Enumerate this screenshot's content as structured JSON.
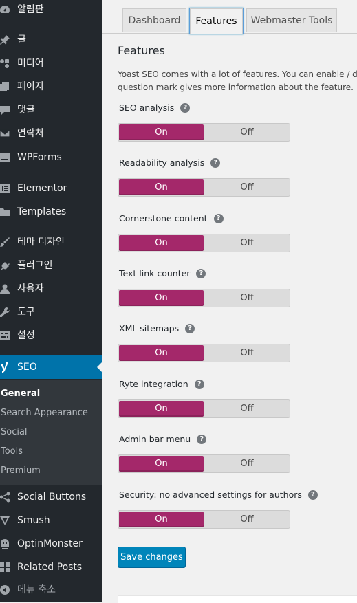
{
  "sidebar": {
    "items": [
      {
        "label": "알림판",
        "icon": "dashboard-icon"
      },
      {
        "label": "글",
        "icon": "pin-icon"
      },
      {
        "label": "미디어",
        "icon": "media-icon"
      },
      {
        "label": "페이지",
        "icon": "pages-icon"
      },
      {
        "label": "댓글",
        "icon": "comments-icon"
      },
      {
        "label": "연락처",
        "icon": "mail-icon"
      },
      {
        "label": "WPForms",
        "icon": "forms-icon"
      },
      {
        "label": "Elementor",
        "icon": "elementor-icon"
      },
      {
        "label": "Templates",
        "icon": "folder-icon"
      },
      {
        "label": "테마 디자인",
        "icon": "brush-icon"
      },
      {
        "label": "플러그인",
        "icon": "plugin-icon"
      },
      {
        "label": "사용자",
        "icon": "user-icon"
      },
      {
        "label": "도구",
        "icon": "wrench-icon"
      },
      {
        "label": "설정",
        "icon": "settings-icon"
      },
      {
        "label": "SEO",
        "icon": "yoast-icon"
      },
      {
        "label": "Social Buttons",
        "icon": "share-icon"
      },
      {
        "label": "Smush",
        "icon": "smush-icon"
      },
      {
        "label": "OptinMonster",
        "icon": "monster-icon"
      },
      {
        "label": "Related Posts",
        "icon": "grid-icon"
      },
      {
        "label": "메뉴 축소",
        "icon": "collapse-icon"
      }
    ],
    "submenu": [
      {
        "label": "General"
      },
      {
        "label": "Search Appearance"
      },
      {
        "label": "Social"
      },
      {
        "label": "Tools"
      },
      {
        "label": "Premium"
      }
    ]
  },
  "tabs": [
    {
      "label": "Dashboard"
    },
    {
      "label": "Features"
    },
    {
      "label": "Webmaster Tools"
    }
  ],
  "section": {
    "title": "Features",
    "description_line1": "Yoast SEO comes with a lot of features. You can enable / disa",
    "description_line2": "question mark gives more information about the feature."
  },
  "features": [
    {
      "label": "SEO analysis",
      "on": "On",
      "off": "Off",
      "state": "on"
    },
    {
      "label": "Readability analysis",
      "on": "On",
      "off": "Off",
      "state": "on"
    },
    {
      "label": "Cornerstone content",
      "on": "On",
      "off": "Off",
      "state": "on"
    },
    {
      "label": "Text link counter",
      "on": "On",
      "off": "Off",
      "state": "on"
    },
    {
      "label": "XML sitemaps",
      "on": "On",
      "off": "Off",
      "state": "on"
    },
    {
      "label": "Ryte integration",
      "on": "On",
      "off": "Off",
      "state": "on"
    },
    {
      "label": "Admin bar menu",
      "on": "On",
      "off": "Off",
      "state": "on"
    },
    {
      "label": "Security: no advanced settings for authors",
      "on": "On",
      "off": "Off",
      "state": "on"
    }
  ],
  "help_glyph": "?",
  "save_label": "Save changes",
  "colors": {
    "sidebar_bg": "#23282d",
    "active_menu": "#0073aa",
    "toggle_on": "#a4286a",
    "button_primary": "#0085ba"
  }
}
